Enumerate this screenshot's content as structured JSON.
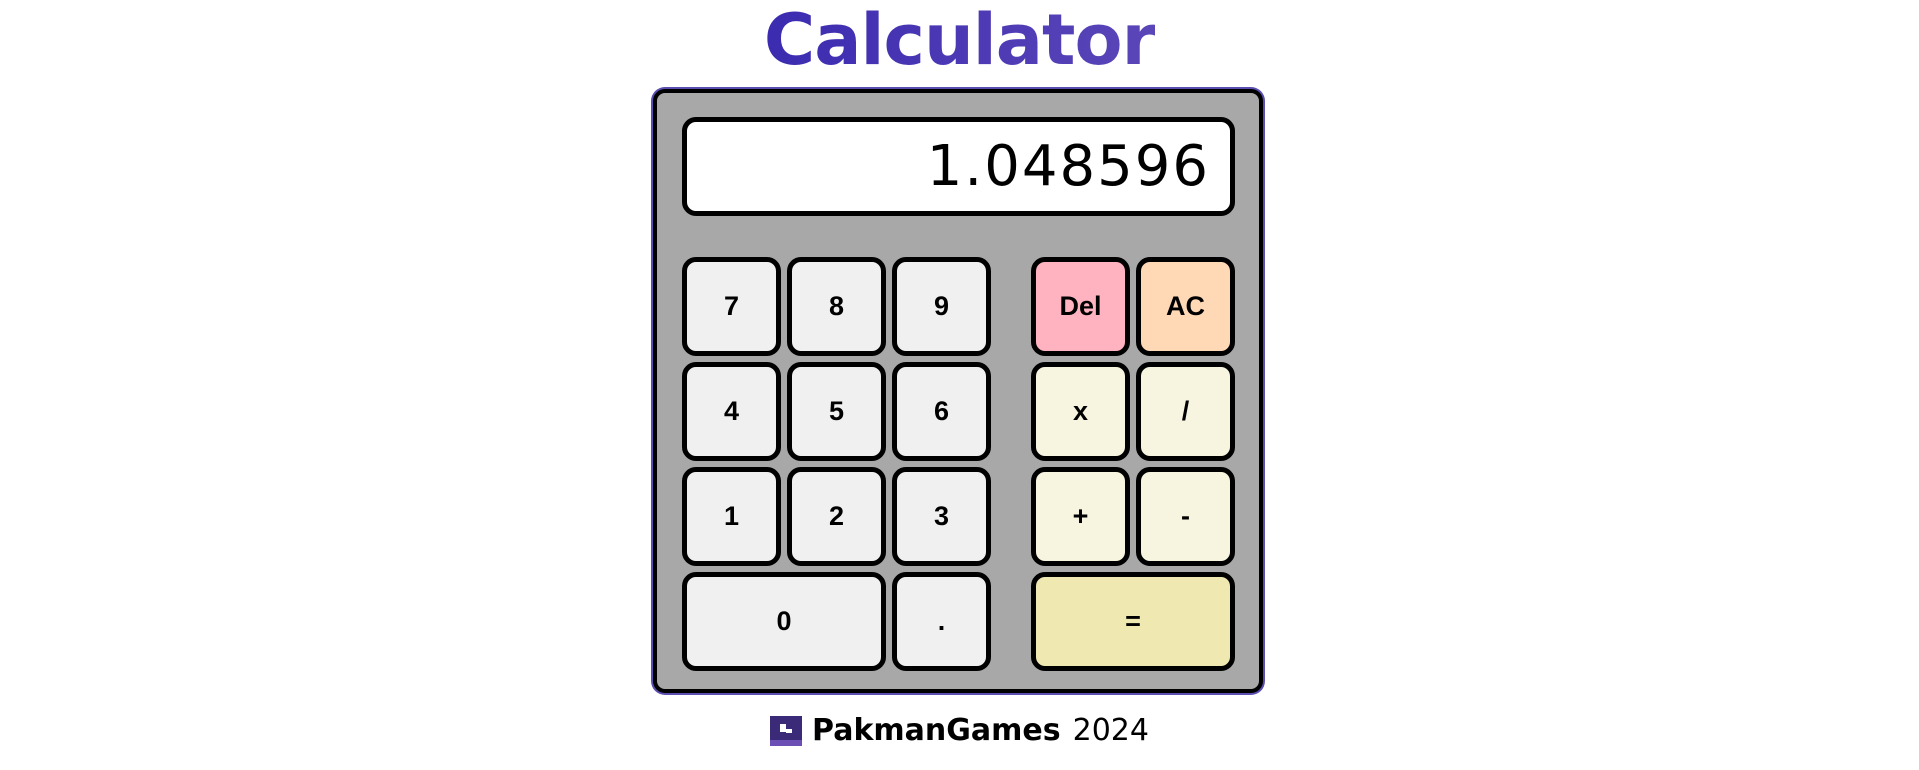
{
  "header": {
    "title": "Calculator"
  },
  "display": {
    "value": "1.048596"
  },
  "keypad": {
    "seven": "7",
    "eight": "8",
    "nine": "9",
    "four": "4",
    "five": "5",
    "six": "6",
    "one": "1",
    "two": "2",
    "three": "3",
    "zero": "0",
    "decimal": ".",
    "del": "Del",
    "ac": "AC",
    "multiply": "x",
    "divide": "/",
    "add": "+",
    "subtract": "-",
    "equals": "="
  },
  "colors": {
    "title_start": "#3b2bb0",
    "title_end": "#5b46b8",
    "body": "#a8a8a8",
    "digit_key": "#f0f0f0",
    "operator_key": "#f7f4df",
    "del_key": "#ffb2c0",
    "ac_key": "#ffd9b6",
    "equals_key": "#efe8b0"
  },
  "footer": {
    "brand": "PakmanGames",
    "year": "2024",
    "logo_icon": "pakman-logo-icon"
  }
}
